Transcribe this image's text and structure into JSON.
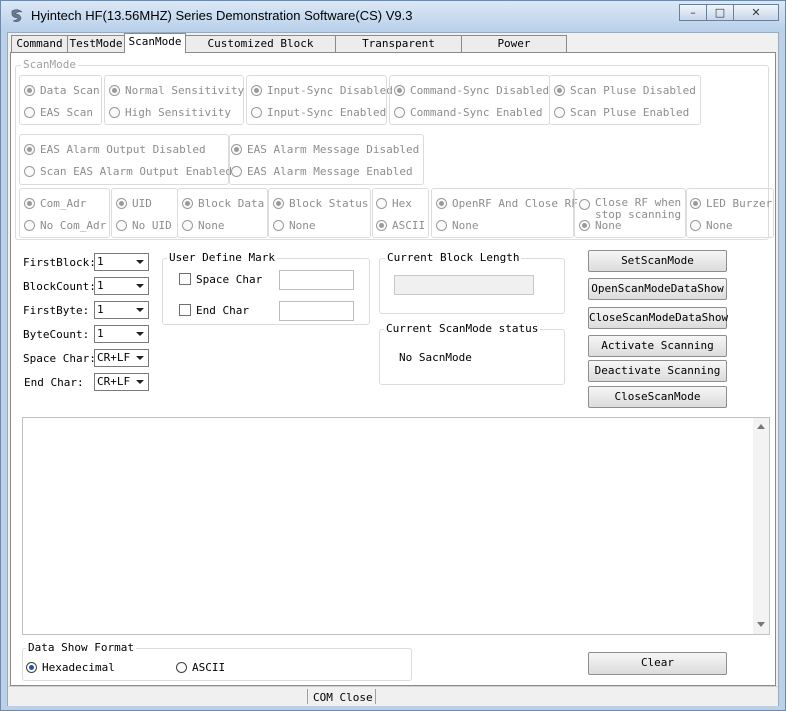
{
  "window": {
    "title": "Hyintech HF(13.56MHZ) Series Demonstration Software(CS) V9.3",
    "controls": {
      "minimize": "–",
      "maximize": "□",
      "close": "✕"
    }
  },
  "tabs": [
    "Command",
    "TestMode",
    "ScanMode",
    "Customized Block Length",
    "Transparent Command",
    "Power Allocation"
  ],
  "scanmode": {
    "legend": "ScanMode",
    "row1": [
      {
        "a": "Data Scan",
        "b": "EAS Scan"
      },
      {
        "a": "Normal Sensitivity",
        "b": "High Sensitivity"
      },
      {
        "a": "Input-Sync Disabled",
        "b": "Input-Sync Enabled"
      },
      {
        "a": "Command-Sync Disabled",
        "b": "Command-Sync Enabled"
      },
      {
        "a": "Scan Pluse Disabled",
        "b": "Scan Pluse Enabled"
      }
    ],
    "row2": [
      {
        "a": "EAS Alarm Output Disabled",
        "b": "Scan EAS Alarm Output Enabled"
      },
      {
        "a": "EAS Alarm Message Disabled",
        "b": "EAS Alarm Message Enabled"
      }
    ],
    "row3": [
      {
        "a": "Com_Adr",
        "b": "No Com_Adr"
      },
      {
        "a": "UID",
        "b": "No UID"
      },
      {
        "a": "Block Data",
        "b": "None"
      },
      {
        "a": "Block Status",
        "b": "None"
      },
      {
        "a": "Hex",
        "b": "ASCII"
      },
      {
        "a": "OpenRF And Close RF",
        "b": "None"
      },
      {
        "a1": "Close RF when",
        "a2": "stop scanning",
        "b": "None"
      },
      {
        "a": "LED Burzer",
        "b": "None"
      }
    ]
  },
  "params": [
    {
      "label": "FirstBlock:",
      "value": "1"
    },
    {
      "label": "BlockCount:",
      "value": "1"
    },
    {
      "label": "FirstByte:",
      "value": "1"
    },
    {
      "label": "ByteCount:",
      "value": "1"
    },
    {
      "label": "Space Char:",
      "value": "CR+LF"
    },
    {
      "label": "End Char:",
      "value": "CR+LF"
    }
  ],
  "user_mark": {
    "legend": "User Define Mark",
    "space_char": "Space Char",
    "end_char": "End Char"
  },
  "block_length": {
    "legend": "Current Block Length"
  },
  "scan_status": {
    "legend": "Current ScanMode status",
    "value": "No SacnMode"
  },
  "buttons": [
    "SetScanMode",
    "OpenScanModeDataShow",
    "CloseScanModeDataShow",
    "Activate Scanning",
    "Deactivate Scanning",
    "CloseScanMode"
  ],
  "data_show": {
    "legend": "Data Show Format",
    "hex": "Hexadecimal",
    "ascii": "ASCII"
  },
  "clear_label": "Clear",
  "status_bar": {
    "com": "COM Close"
  }
}
